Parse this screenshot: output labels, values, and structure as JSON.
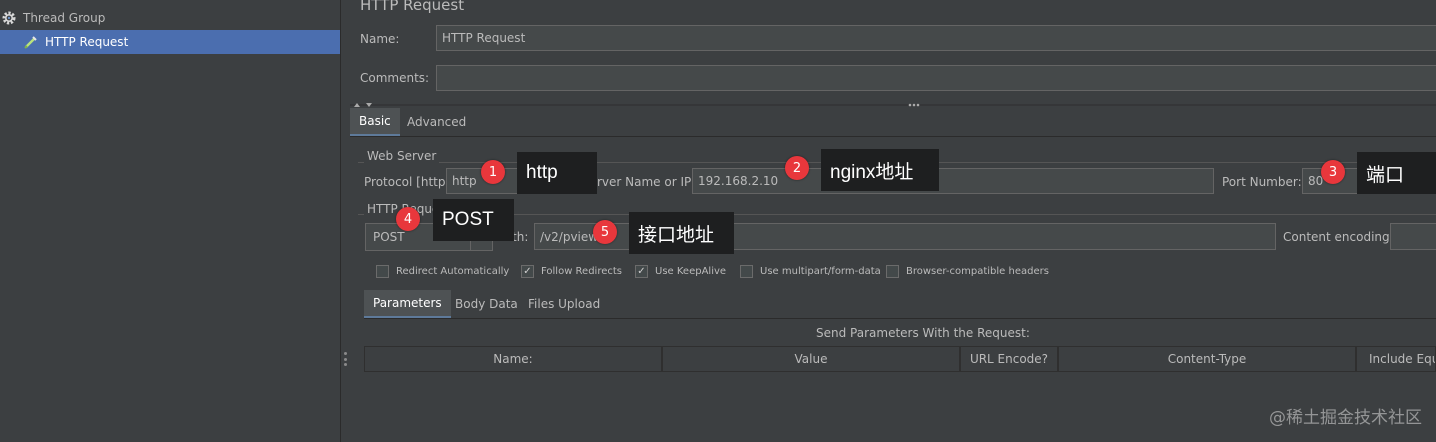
{
  "tree": {
    "items": [
      {
        "label": "Thread Group",
        "icon": "gear-icon"
      },
      {
        "label": "HTTP Request",
        "icon": "pipette-icon",
        "selected": true
      }
    ]
  },
  "panel": {
    "title": "HTTP Request",
    "name_label": "Name:",
    "name_value": "HTTP Request",
    "comments_label": "Comments:",
    "comments_value": ""
  },
  "tabs": {
    "basic": "Basic",
    "advanced": "Advanced"
  },
  "web_server": {
    "group_label": "Web Server",
    "protocol_label": "Protocol [http]:",
    "protocol_value": "http",
    "server_label": "Server Name or IP:",
    "server_value": "192.168.2.10",
    "port_label": "Port Number:",
    "port_value": "80"
  },
  "http_request": {
    "group_label": "HTTP Request",
    "method_value": "POST",
    "path_label": "Path:",
    "path_value": "/v2/pview",
    "encoding_label": "Content encoding:",
    "encoding_value": ""
  },
  "options": [
    {
      "label": "Redirect Automatically",
      "checked": false
    },
    {
      "label": "Follow Redirects",
      "checked": true
    },
    {
      "label": "Use KeepAlive",
      "checked": true
    },
    {
      "label": "Use multipart/form-data",
      "checked": false
    },
    {
      "label": "Browser-compatible headers",
      "checked": false
    }
  ],
  "subtabs": {
    "parameters": "Parameters",
    "body_data": "Body Data",
    "files_upload": "Files Upload"
  },
  "params": {
    "caption": "Send Parameters With the Request:",
    "columns": [
      "Name:",
      "Value",
      "URL Encode?",
      "Content-Type",
      "Include Equa"
    ]
  },
  "annotations": [
    {
      "num": "1",
      "text": "http"
    },
    {
      "num": "2",
      "text": "nginx地址"
    },
    {
      "num": "3",
      "text": "端口"
    },
    {
      "num": "4",
      "text": "POST"
    },
    {
      "num": "5",
      "text": "接口地址"
    }
  ],
  "watermark": "@稀土掘金技术社区",
  "colors": {
    "selection": "#4b6eaf",
    "badge": "#e8373c",
    "background": "#3c3f41",
    "callout": "#1e1f20"
  }
}
